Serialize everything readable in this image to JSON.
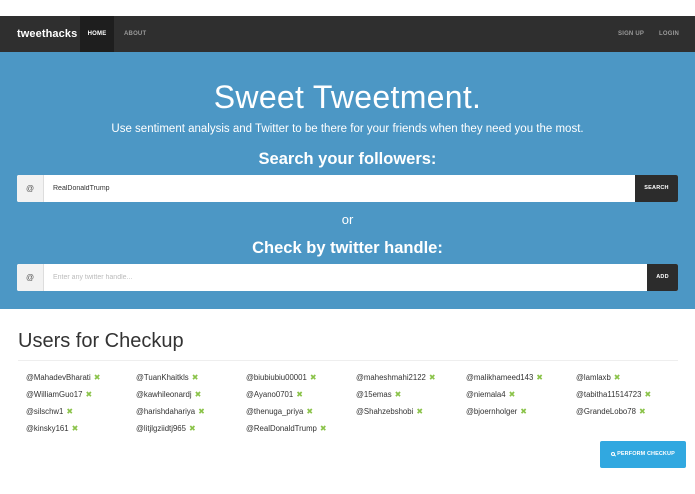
{
  "navbar": {
    "brand": "tweethacks",
    "items": [
      {
        "label": "HOME",
        "active": true
      },
      {
        "label": "ABOUT",
        "active": false
      }
    ],
    "right_items": [
      {
        "label": "SIGN UP"
      },
      {
        "label": "LOGIN"
      }
    ]
  },
  "hero": {
    "title": "Sweet Tweetment.",
    "subtitle": "Use sentiment analysis and Twitter to be there for your friends when they need you the most.",
    "search_heading": "Search your followers:",
    "or_text": "or",
    "handle_heading": "Check by twitter handle:"
  },
  "search": {
    "addon": "@",
    "value": "RealDonaldTrump",
    "button_label": "SEARCH"
  },
  "add_handle": {
    "addon": "@",
    "placeholder": "Enter any twitter handle...",
    "value": "",
    "button_label": "ADD"
  },
  "users_section": {
    "title": "Users for Checkup",
    "remove_icon": "✖",
    "users": [
      "@MahadevBharati",
      "@TuanKhaitkls",
      "@biubiubiu00001",
      "@maheshmahi2122",
      "@malikhameed143",
      "@lamlaxb",
      "@WilliamGuo17",
      "@kawhileonardj",
      "@Ayano0701",
      "@15emas",
      "@niemala4",
      "@tabitha11514723",
      "@silschw1",
      "@harishdahariya",
      "@thenuga_priya",
      "@Shahzebshobi",
      "@bjoernholger",
      "@GrandeLobo78",
      "@kinsky161",
      "@litjlgziidtj965",
      "@RealDonaldTrump"
    ]
  },
  "perform_button": {
    "label": "PERFORM CHECKUP",
    "icon": "search-icon"
  },
  "colors": {
    "navbar_bg": "#2f2f2f",
    "hero_bg": "#4c97c5",
    "remove_icon": "#8bc34a",
    "perform_button_bg": "#31a8e0",
    "dark_button_bg": "#2c2c2c"
  }
}
